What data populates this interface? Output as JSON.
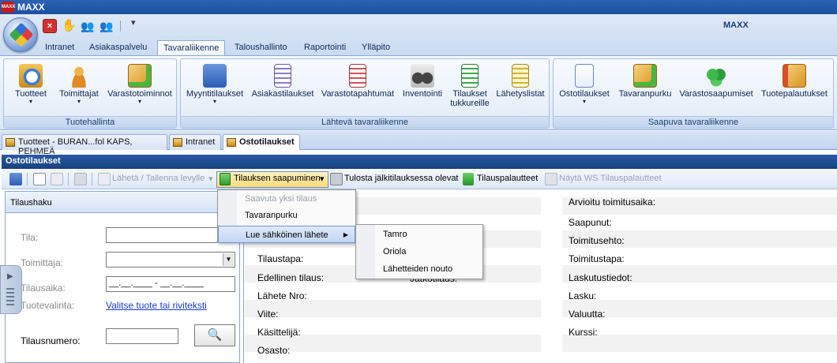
{
  "app": {
    "title": "MAXX",
    "right_title": "MAXX",
    "logo_text": "MAXX"
  },
  "tabs": [
    "Intranet",
    "Asiakaspalvelu",
    "Tavaraliikenne",
    "Taloushallinto",
    "Raportointi",
    "Ylläpito"
  ],
  "active_tab": "Tavaraliikenne",
  "ribbon": {
    "groups": [
      {
        "title": "Tuotehallinta",
        "buttons": [
          "Tuotteet",
          "Toimittajat",
          "Varastotoiminnot"
        ]
      },
      {
        "title": "Lähtevä tavaraliikenne",
        "buttons": [
          "Myyntitilaukset",
          "Asiakastilaukset",
          "Varastotapahtumat",
          "Inventointi",
          "Tilaukset tukkureille",
          "Lähetyslistat"
        ]
      },
      {
        "title": "Saapuva tavaraliikenne",
        "buttons": [
          "Ostotilaukset",
          "Tavaranpurku",
          "Varastosaapumiset",
          "Tuotepalautukset"
        ]
      }
    ]
  },
  "doc_tabs": [
    "Tuotteet - BURAN...fol KAPS, PEHMEÄ",
    "Intranet",
    "Ostotilaukset"
  ],
  "section_title": "Ostotilaukset",
  "toolbar": {
    "send_save": "Lähetä / Tallenna levylle",
    "arrival": "Tilauksen saapuminen",
    "print_backorder": "Tulosta jälkitilauksessa olevat",
    "order_feedback": "Tilauspalautteet",
    "ws_feedback": "Näytä WS Tilauspalautteet"
  },
  "menu": {
    "items": [
      "Saavuta yksi tilaus",
      "Tavaranpurku",
      "Lue sähköinen lähete"
    ],
    "submenu": [
      "Tamro",
      "Oriola",
      "Lähetteiden nouto"
    ]
  },
  "search_panel": {
    "title": "Tilaushaku",
    "tila_label": "Tila:",
    "toimittaja_label": "Toimittaja:",
    "tilausaika_label": "Tilausaika:",
    "tilausaika_value": "__.__.____ - __.__.____",
    "tuotevalinta_label": "Tuotevalinta:",
    "tuotevalinta_link": "Valitse tuote tai riviteksti",
    "tilausnumero_label": "Tilausnumero:"
  },
  "details_left": [
    "Tilaustapa:",
    "Edellinen tilaus:",
    "Lähete Nro:",
    "Viite:",
    "Käsittelijä:",
    "Osasto:"
  ],
  "details_left_extra": "Jatkotilaus:",
  "details_right": [
    "Arvioitu toimitusaika:",
    "Saapunut:",
    "Toimitusehto:",
    "Toimitustapa:",
    "Laskutustiedot:",
    "Lasku:",
    "Valuutta:",
    "Kurssi:"
  ],
  "colors": {
    "accent": "#2a5ba6",
    "ribbon": "#dbe7f7",
    "highlight": "#c2d6f6"
  }
}
